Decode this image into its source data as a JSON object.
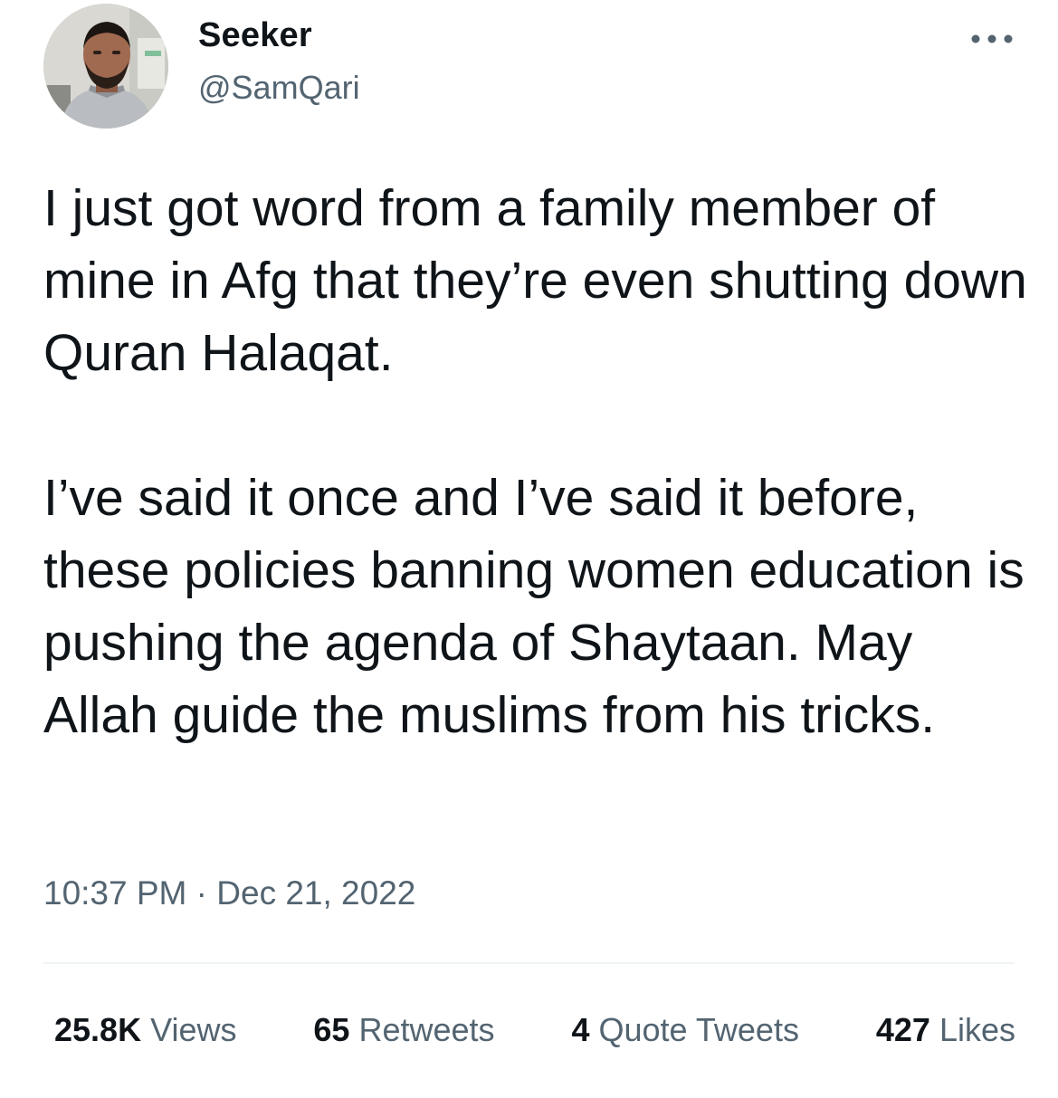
{
  "author": {
    "display_name": "Seeker",
    "handle": "@SamQari",
    "avatar_icon": "profile-photo"
  },
  "more_icon": "more-options-icon",
  "tweet": {
    "paragraphs": [
      "I just got word from a family member of mine in Afg that they’re even shutting down Quran Halaqat.",
      "I’ve said it once and I’ve said it before, these policies banning women education is pushing the agenda of Shaytaan. May Allah guide the muslims from his tricks."
    ],
    "time": "10:37 PM",
    "separator": "·",
    "date": "Dec 21, 2022"
  },
  "stats": {
    "views": {
      "count": "25.8K",
      "label": "Views"
    },
    "retweets": {
      "count": "65",
      "label": "Retweets"
    },
    "quote_tweets": {
      "count": "4",
      "label": "Quote Tweets"
    },
    "likes": {
      "count": "427",
      "label": "Likes"
    }
  },
  "colors": {
    "text_primary": "#0f1419",
    "text_secondary": "#536471",
    "divider": "#eff3f4",
    "background": "#ffffff"
  }
}
